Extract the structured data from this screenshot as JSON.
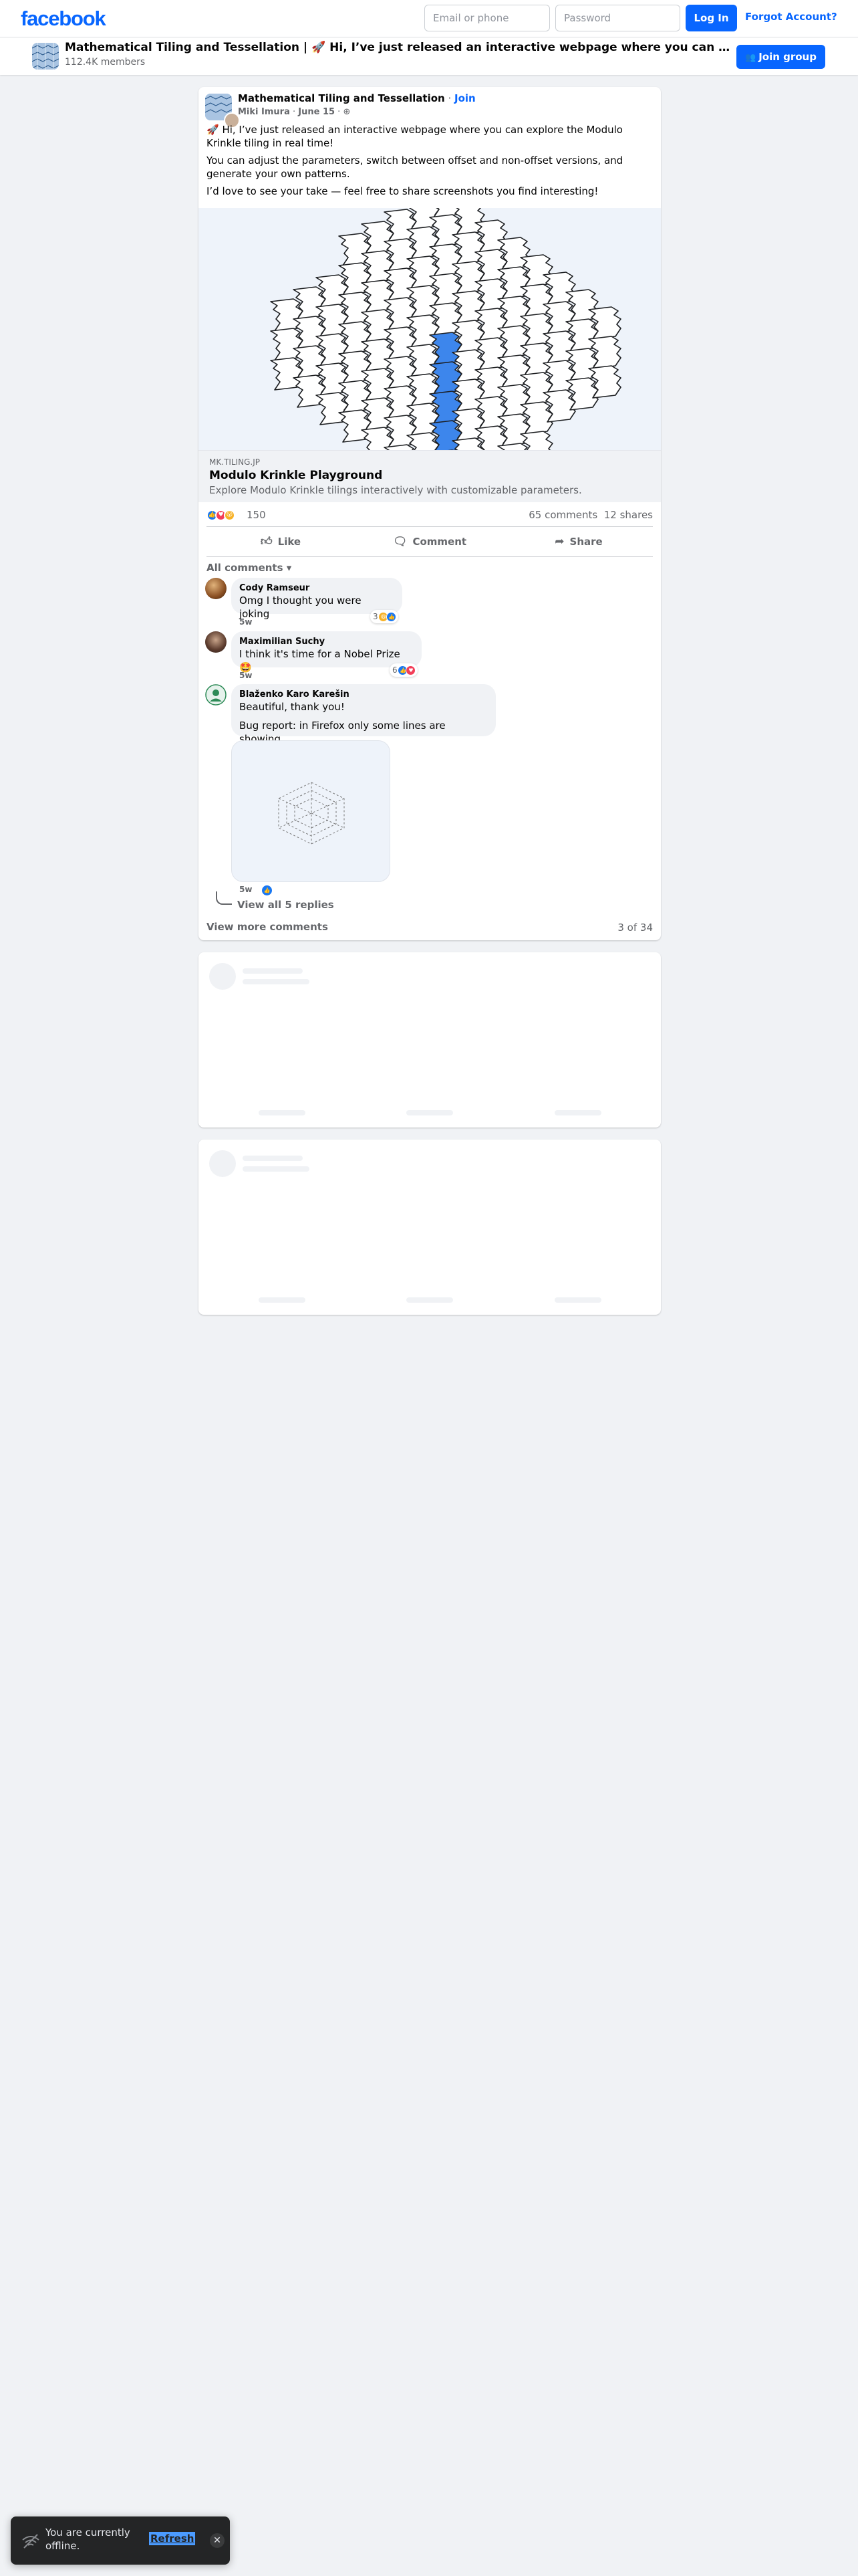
{
  "topbar": {
    "logo": "facebook",
    "email_placeholder": "Email or phone",
    "password_placeholder": "Password",
    "login_label": "Log In",
    "forgot_label": "Forgot Account?"
  },
  "groupbar": {
    "title": "Mathematical Tiling and Tessellation | 🚀 Hi, I’ve just released an interactive webpage where you can explore the Modulo Krinkle tiling in real time!",
    "members": "112.4K members",
    "join_label": "Join group"
  },
  "post": {
    "group_name": "Mathematical Tiling and Tessellation",
    "separator": " · ",
    "join_label": "Join",
    "author": "Miki Imura",
    "date": "June 15",
    "paragraphs": [
      "🚀 Hi, I’ve just released an interactive webpage where you can explore the Modulo Krinkle tiling in real time!",
      "You can adjust the parameters, switch between offset and non-offset versions, and generate your own patterns.",
      "I’d love to see your take — feel free to share screenshots you find interesting!"
    ],
    "link": {
      "domain": "MK.TILING.JP",
      "title": "Modulo Krinkle Playground",
      "description": "Explore Modulo Krinkle tilings interactively with customizable parameters."
    },
    "reaction_count": "150",
    "comments_count": "65 comments",
    "shares_count": "12 shares",
    "actions": {
      "like": "Like",
      "comment": "Comment",
      "share": "Share"
    },
    "all_comments_label": "All comments",
    "comments": [
      {
        "name": "Cody Ramseur",
        "text": "Omg I thought you were joking",
        "time": "5w",
        "reaction_count": "3"
      },
      {
        "name": "Maximilian Suchy",
        "text": "I think it's time for a Nobel Prize 🤩",
        "time": "5w",
        "reaction_count": "6"
      },
      {
        "name": "Blaženko Karo Karešin",
        "text1": "Beautiful, thank you!",
        "text2": "Bug report: in Firefox only some lines are showing",
        "time": "5w"
      }
    ],
    "view_replies_label": "View all 5 replies",
    "view_more_label": "View more comments",
    "page_counter": "3 of 34"
  },
  "toast": {
    "text": "You are currently offline.",
    "refresh_label": "Refresh"
  },
  "colors": {
    "brand_blue": "#0866ff",
    "tile_blue": "#3d86ec",
    "background": "#f0f2f5"
  }
}
